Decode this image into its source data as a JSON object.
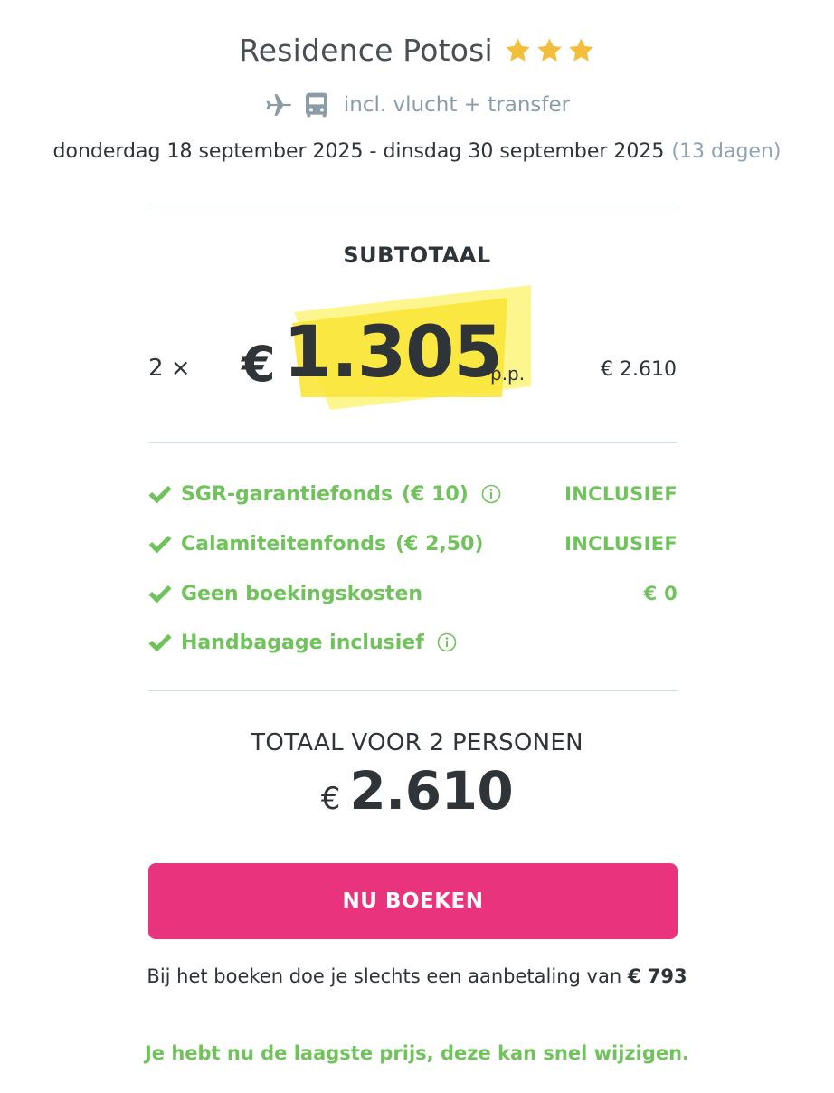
{
  "header": {
    "hotel_name": "Residence Potosi",
    "stars": 3,
    "star_color": "#f3bf3a",
    "includes_text": "incl. vlucht + transfer",
    "includes_icons": [
      "airplane-icon",
      "bus-icon"
    ],
    "dates": "donderdag 18 september 2025 - dinsdag 30 september 2025",
    "duration": "(13 dagen)"
  },
  "subtotal": {
    "label": "SUBTOTAAL",
    "quantity": "2 ×",
    "currency": "€",
    "price_per_person": "1.305",
    "per_person_label": "p.p.",
    "line_total": "€ 2.610",
    "highlight_color": "#fbe94f"
  },
  "inclusions": [
    {
      "label": "SGR-garantiefonds",
      "amount": "(€ 10)",
      "info": true,
      "value": "INCLUSIEF"
    },
    {
      "label": "Calamiteitenfonds",
      "amount": "(€ 2,50)",
      "info": false,
      "value": "INCLUSIEF"
    },
    {
      "label": "Geen boekingskosten",
      "amount": "",
      "info": false,
      "value": "€ 0"
    },
    {
      "label": "Handbagage inclusief",
      "amount": "",
      "info": true,
      "value": ""
    }
  ],
  "total": {
    "label": "TOTAAL VOOR 2 PERSONEN",
    "currency": "€",
    "amount": "2.610"
  },
  "cta": {
    "label": "NU BOEKEN",
    "color": "#ea337d"
  },
  "deposit": {
    "text": "Bij het boeken doe je slechts een aanbetaling van",
    "amount": "€ 793"
  },
  "notice": "Je hebt nu de laagste prijs, deze kan snel wijzigen.",
  "colors": {
    "accent_green": "#6fc35a",
    "muted_blue_gray": "#8fa3b3",
    "text_dark": "#2f3438"
  }
}
